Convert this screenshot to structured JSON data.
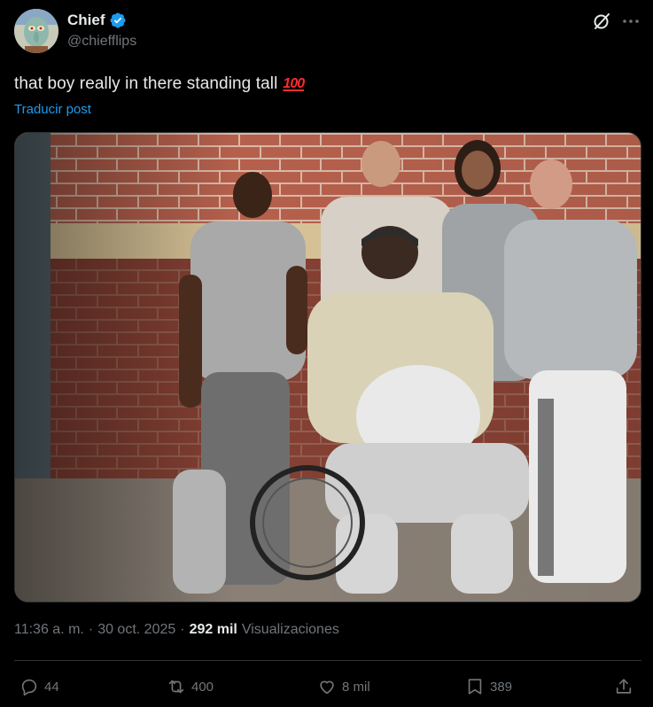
{
  "author": {
    "display_name": "Chief",
    "handle": "@chiefflips",
    "verified": true
  },
  "tweet": {
    "text": "that boy really in there standing tall",
    "emoji": "100",
    "translate_label": "Traducir post"
  },
  "meta": {
    "time": "11:36 a. m.",
    "separator1": "·",
    "date": "30 oct. 2025",
    "separator2": "·",
    "views_count": "292 mil",
    "views_label": "Visualizaciones"
  },
  "actions": {
    "replies": "44",
    "reposts": "400",
    "likes": "8 mil",
    "bookmarks": "389"
  },
  "colors": {
    "background": "#000000",
    "text": "#e7e9ea",
    "muted": "#71767b",
    "link": "#1d9bf0",
    "divider": "#2f3336"
  },
  "icons": [
    "verified-badge-icon",
    "grok-icon",
    "more-icon",
    "reply-icon",
    "repost-icon",
    "like-icon",
    "bookmark-icon",
    "share-icon"
  ]
}
